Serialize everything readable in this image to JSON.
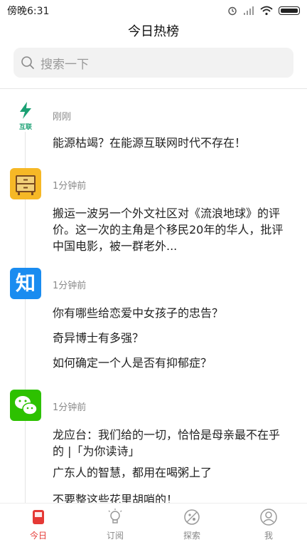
{
  "status_bar": {
    "time": "傍晚6:31"
  },
  "header": {
    "title": "今日热榜"
  },
  "search": {
    "placeholder": "搜索一下"
  },
  "feed": [
    {
      "source_icon": "lightning-icon",
      "source_label": "互联",
      "time": "刚刚",
      "headlines": [
        "能源枯竭？在能源互联网时代不存在！"
      ]
    },
    {
      "source_icon": "drawer-cabinet-icon",
      "time": "1分钟前",
      "headlines": [
        "搬运一波另一个外文社区对《流浪地球》的评价。这一次的主角是个移民20年的华人，批评中国电影，被一群老外..."
      ]
    },
    {
      "source_icon": "zhihu-icon",
      "source_label": "知",
      "time": "1分钟前",
      "headlines": [
        "你有哪些给恋爱中女孩子的忠告？",
        "奇异博士有多强？",
        "如何确定一个人是否有抑郁症？"
      ]
    },
    {
      "source_icon": "wechat-icon",
      "time": "1分钟前",
      "headlines": [
        "龙应台：我们给的一切，恰恰是母亲最不在乎的 |「为你读诗」",
        "广东人的智慧，都用在喝粥上了",
        "不要整这些花里胡哨的！"
      ]
    }
  ],
  "tabs": [
    {
      "label": "今日",
      "icon": "today-icon",
      "active": true
    },
    {
      "label": "订阅",
      "icon": "lightbulb-icon",
      "active": false
    },
    {
      "label": "探索",
      "icon": "planet-icon",
      "active": false
    },
    {
      "label": "我",
      "icon": "user-icon",
      "active": false
    }
  ],
  "colors": {
    "accent": "#e53935",
    "zhihu": "#1a8cf0",
    "wechat": "#2dc100",
    "energy": "#1aa073"
  }
}
